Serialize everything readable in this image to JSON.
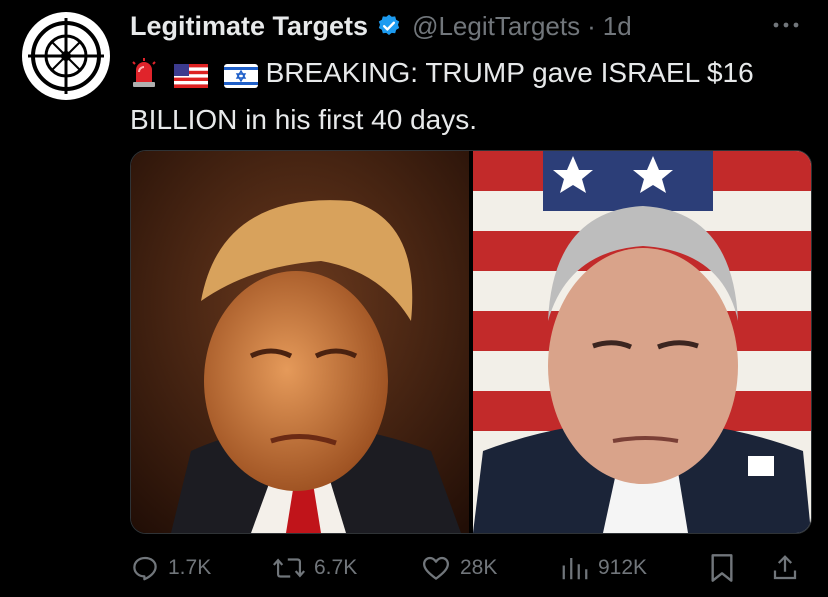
{
  "post": {
    "author_name": "Legitimate Targets",
    "handle": "@LegitTargets",
    "separator": "·",
    "time": "1d",
    "text": "BREAKING: TRUMP gave ISRAEL $16 BILLION in his first 40 days.",
    "emojis": [
      "police-light-emoji",
      "us-flag-emoji",
      "israel-flag-emoji"
    ]
  },
  "media": {
    "left_photo": "portrait-photo",
    "right_photo": "portrait-photo-flag-background"
  },
  "actions": {
    "replies": "1.7K",
    "reposts": "6.7K",
    "likes": "28K",
    "views": "912K"
  },
  "colors": {
    "background": "#000000",
    "text": "#e7e9ea",
    "secondary": "#71767b",
    "verified": "#1d9bf0"
  }
}
